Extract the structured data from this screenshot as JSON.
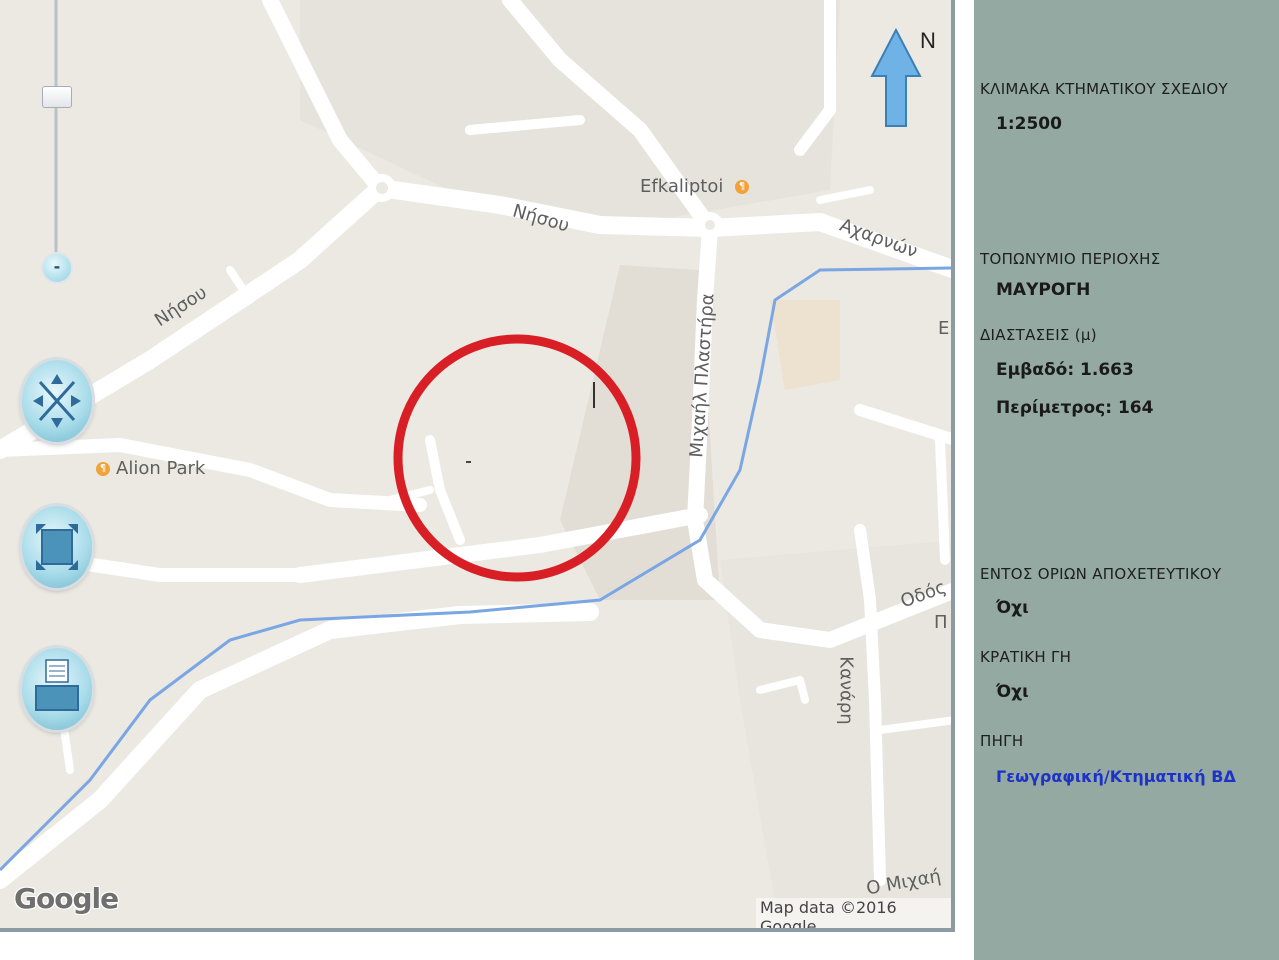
{
  "map": {
    "labels": {
      "efkaliptoi": "Efkaliptoi",
      "nisou_1": "Νήσου",
      "nisou_2": "Νήσου",
      "acharnon": "Αχαρνών",
      "alion_park": "Alion Park",
      "michail_plastira": "Μιχαήλ Πλαστήρα",
      "odos": "Οδός",
      "kanari": "Κανάρη",
      "p_letter": "Π",
      "e_letter": "Ε",
      "michail_bottom": "Ο Μιχαή"
    },
    "north_label": "N",
    "google_logo": "Google",
    "attribution": "Map data ©2016 Google",
    "colors": {
      "background": "#ece9e3",
      "road": "#ffffff",
      "river": "#7aa6e3",
      "circle": "#d91f26",
      "arrow": "#6fb2e6"
    }
  },
  "controls": {
    "zoom_minus": "-",
    "zoom_level": 0.33,
    "pan_icon": "pan-arrows-icon",
    "fullscreen_icon": "fullscreen-icon",
    "print_icon": "printer-icon"
  },
  "info": {
    "scale_label": "ΚΛΙΜΑΚΑ ΚΤΗΜΑΤΙΚΟΥ ΣΧΕΔΙΟΥ",
    "scale_value": "1:2500",
    "toponym_label": "ΤΟΠΩΝΥΜΙΟ ΠΕΡΙΟΧΗΣ",
    "toponym_value": "ΜΑΥΡΟΓΗ",
    "dimensions_label": "ΔΙΑΣΤΑΣΕΙΣ (μ)",
    "area_value": "Εμβαδό: 1.663",
    "perimeter_value": "Περίμετρος: 164",
    "sewer_label": "ΕΝΤΟΣ ΟΡΙΩΝ ΑΠΟΧΕΤΕΥΤΙΚΟΥ",
    "sewer_value": "Όχι",
    "state_land_label": "ΚΡΑΤΙΚΗ ΓΗ",
    "state_land_value": "Όχι",
    "source_label": "ΠΗΓΗ",
    "source_value": "Γεωγραφική/Κτηματική ΒΔ"
  }
}
